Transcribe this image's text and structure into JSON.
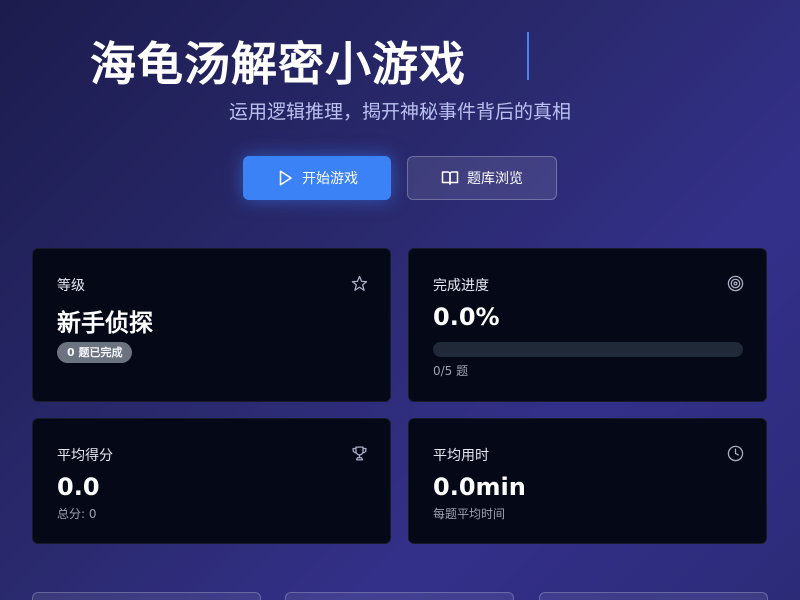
{
  "hero": {
    "title": "海龟汤解密小游戏",
    "subtitle": "运用逻辑推理，揭开神秘事件背后的真相"
  },
  "actions": {
    "start_label": "开始游戏",
    "browse_label": "题库浏览"
  },
  "stats": {
    "level": {
      "label": "等级",
      "value": "新手侦探",
      "badge": "0 题已完成",
      "icon": "star-icon"
    },
    "progress": {
      "label": "完成进度",
      "value": "0.0%",
      "percent": 0,
      "note": "0/5 题",
      "icon": "target-icon"
    },
    "avg_score": {
      "label": "平均得分",
      "value": "0.0",
      "note": "总分: 0",
      "icon": "trophy-icon"
    },
    "avg_time": {
      "label": "平均用时",
      "value": "0.0min",
      "note": "每题平均时间",
      "icon": "clock-icon"
    }
  },
  "colors": {
    "accent": "#3b82f6",
    "card_bg": "#050816",
    "badge_bg": "#6b7280"
  }
}
